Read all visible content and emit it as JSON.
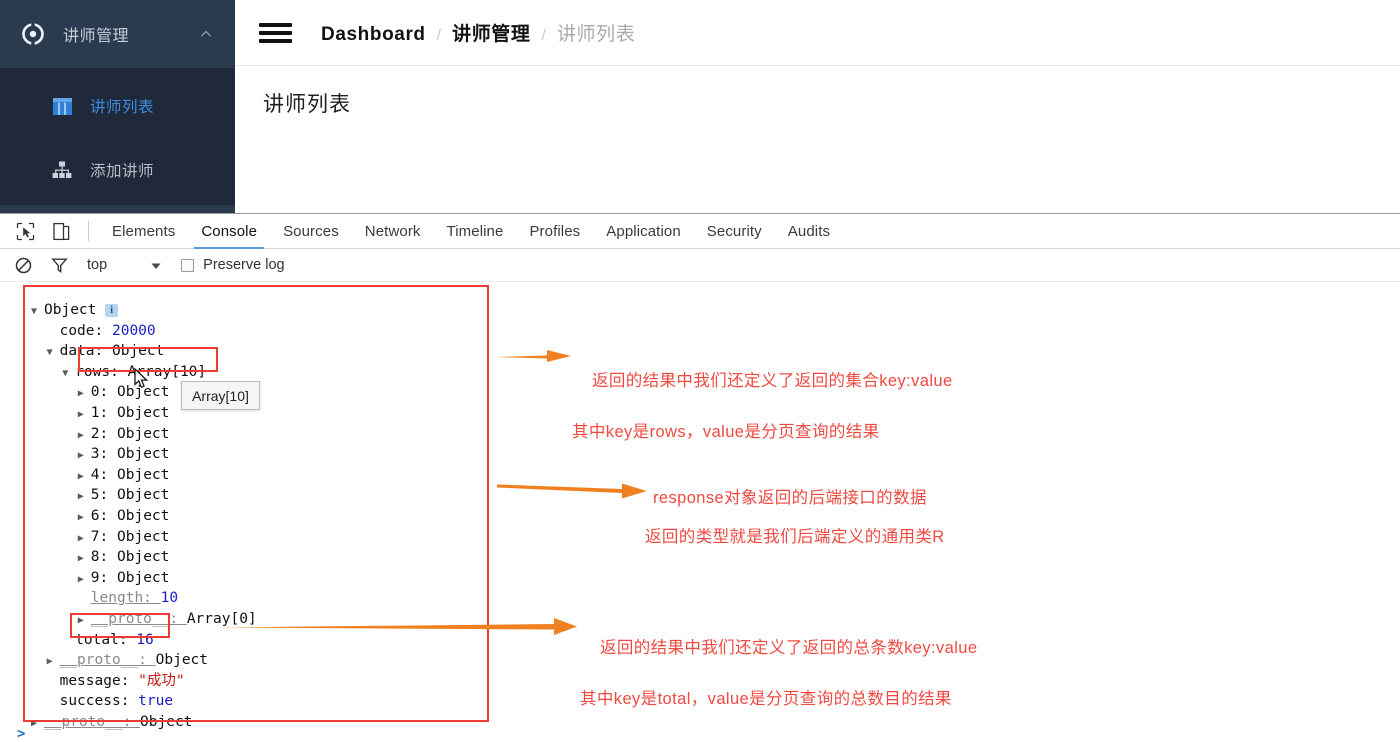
{
  "sidebar": {
    "logo_icon": "target-circle-icon",
    "title": "讲师管理",
    "collapse_icon": "chevron-up-icon",
    "items": [
      {
        "icon": "table-grid-icon",
        "label": "讲师列表",
        "active": true
      },
      {
        "icon": "sitemap-icon",
        "label": "添加讲师",
        "active": false
      }
    ]
  },
  "header": {
    "menu_icon": "hamburger-menu-icon",
    "breadcrumb": [
      "Dashboard",
      "讲师管理",
      "讲师列表"
    ],
    "separator": "/"
  },
  "main": {
    "page_title": "讲师列表"
  },
  "devtools": {
    "inspect_icon": "inspect-element-icon",
    "device_icon": "device-toolbar-icon",
    "tabs": [
      "Elements",
      "Console",
      "Sources",
      "Network",
      "Timeline",
      "Profiles",
      "Application",
      "Security",
      "Audits"
    ],
    "active_tab": "Console",
    "filter_bar": {
      "clear_icon": "clear-console-icon",
      "filter_icon": "filter-funnel-icon",
      "context": "top",
      "context_caret": "caret-down-icon",
      "preserve_log_label": "Preserve log",
      "preserve_log_checked": false
    },
    "tooltip": "Array[10]",
    "prompt": ">",
    "console_tree": [
      {
        "indent": 0,
        "toggle": "▼",
        "text": "Object",
        "badge": "i"
      },
      {
        "indent": 1,
        "toggle": "",
        "key": "code",
        "value": "20000",
        "value_type": "num"
      },
      {
        "indent": 1,
        "toggle": "▼",
        "key": "data",
        "value": "Object",
        "value_type": "plain"
      },
      {
        "indent": 2,
        "toggle": "▼",
        "key": "rows",
        "value": "Array[10]",
        "value_type": "plain",
        "boxed": true
      },
      {
        "indent": 3,
        "toggle": "▶",
        "key": "0",
        "value": "Object",
        "value_type": "plain"
      },
      {
        "indent": 3,
        "toggle": "▶",
        "key": "1",
        "value": "Object",
        "value_type": "plain"
      },
      {
        "indent": 3,
        "toggle": "▶",
        "key": "2",
        "value": "Object",
        "value_type": "plain"
      },
      {
        "indent": 3,
        "toggle": "▶",
        "key": "3",
        "value": "Object",
        "value_type": "plain"
      },
      {
        "indent": 3,
        "toggle": "▶",
        "key": "4",
        "value": "Object",
        "value_type": "plain"
      },
      {
        "indent": 3,
        "toggle": "▶",
        "key": "5",
        "value": "Object",
        "value_type": "plain"
      },
      {
        "indent": 3,
        "toggle": "▶",
        "key": "6",
        "value": "Object",
        "value_type": "plain"
      },
      {
        "indent": 3,
        "toggle": "▶",
        "key": "7",
        "value": "Object",
        "value_type": "plain"
      },
      {
        "indent": 3,
        "toggle": "▶",
        "key": "8",
        "value": "Object",
        "value_type": "plain"
      },
      {
        "indent": 3,
        "toggle": "▶",
        "key": "9",
        "value": "Object",
        "value_type": "plain"
      },
      {
        "indent": 3,
        "toggle": "",
        "key": "length",
        "value": "10",
        "value_type": "num",
        "key_muted": true
      },
      {
        "indent": 3,
        "toggle": "▶",
        "key": "__proto__",
        "value": "Array[0]",
        "value_type": "plain",
        "key_muted": true
      },
      {
        "indent": 2,
        "toggle": "",
        "key": "total",
        "value": "16",
        "value_type": "num",
        "boxed": true
      },
      {
        "indent": 1,
        "toggle": "▶",
        "key": "__proto__",
        "value": "Object",
        "value_type": "plain",
        "key_muted": true
      },
      {
        "indent": 1,
        "toggle": "",
        "key": "message",
        "value": "\"成功\"",
        "value_type": "str"
      },
      {
        "indent": 1,
        "toggle": "",
        "key": "success",
        "value": "true",
        "value_type": "bool"
      },
      {
        "indent": 0,
        "toggle": "▶",
        "key": "__proto__",
        "value": "Object",
        "value_type": "plain",
        "key_muted": true
      }
    ]
  },
  "annotations": {
    "accent_arrow_color": "#f08020",
    "text_color": "#ef4a42",
    "box_color": "#ef3b34",
    "a1_line1": "返回的结果中我们还定义了返回的集合key:value",
    "a1_line2": "其中key是rows，value是分页查询的结果",
    "a2_line1": "response对象返回的后端接口的数据",
    "a2_line2": "返回的类型就是我们后端定义的通用类R",
    "a3_line1": "返回的结果中我们还定义了返回的总条数key:value",
    "a3_line2": "其中key是total，value是分页查询的总数目的结果"
  }
}
